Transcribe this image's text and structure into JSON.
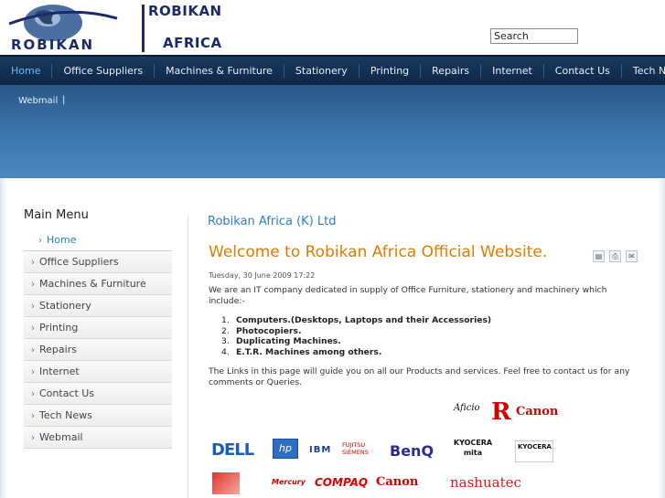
{
  "header": {
    "brand_top": "ROBIKAN",
    "brand_bottom": "AFRICA",
    "logo_text": "ROBIKAN",
    "search_value": "Search"
  },
  "nav": {
    "items": [
      "Home",
      "Office Suppliers",
      "Machines & Furniture",
      "Stationery",
      "Printing",
      "Repairs",
      "Internet",
      "Contact Us",
      "Tech News"
    ]
  },
  "banner": {
    "webmail": "Webmail",
    "separator": "|"
  },
  "sidebar": {
    "title": "Main Menu",
    "items": [
      "Home",
      "Office Suppliers",
      "Machines & Furniture",
      "Stationery",
      "Printing",
      "Repairs",
      "Internet",
      "Contact Us",
      "Tech News",
      "Webmail"
    ]
  },
  "content": {
    "section_title": "Robikan Africa (K) Ltd",
    "welcome": "Welcome to Robikan Africa Official Website.",
    "date": "Tuesday, 30 June 2009 17:22",
    "intro": "We are an IT company dedicated in supply of Office Furniture, stationery and machinery which include:-",
    "list": [
      {
        "num": "1.",
        "text": "Computers.(Desktops, Laptops and their Accessories)"
      },
      {
        "num": "2.",
        "text": "Photocopiers."
      },
      {
        "num": "3.",
        "text": "Duplicating Machines."
      },
      {
        "num": "4.",
        "text": "E.T.R. Machines among others."
      }
    ],
    "links": "The Links in this page will guide you on all our Products and services. Feel free to contact us for any comments or Queries."
  },
  "brand_logos": {
    "aficio": "Aficio",
    "ricoh": "R",
    "canon1": "Canon",
    "dell": "DELL",
    "hp": "hp",
    "ibm": "IBM",
    "fujitsu": "FUJITSU SIEMENS",
    "benq": "BenQ",
    "kyocera_mita": "KYOCERA mita",
    "kyocera2": "KYOCERA",
    "mercury": "Mercury",
    "compaq": "COMPAQ",
    "canon2": "Canon",
    "nashuatec": "nashuatec"
  },
  "colors": {
    "nav_bg": "#0d2744",
    "nav_active": "#6fb6ff",
    "banner": "#3f79b0",
    "title_blue": "#2b7fc4",
    "welcome_orange": "#e07b00",
    "brand_navy": "#1b2a6b"
  }
}
